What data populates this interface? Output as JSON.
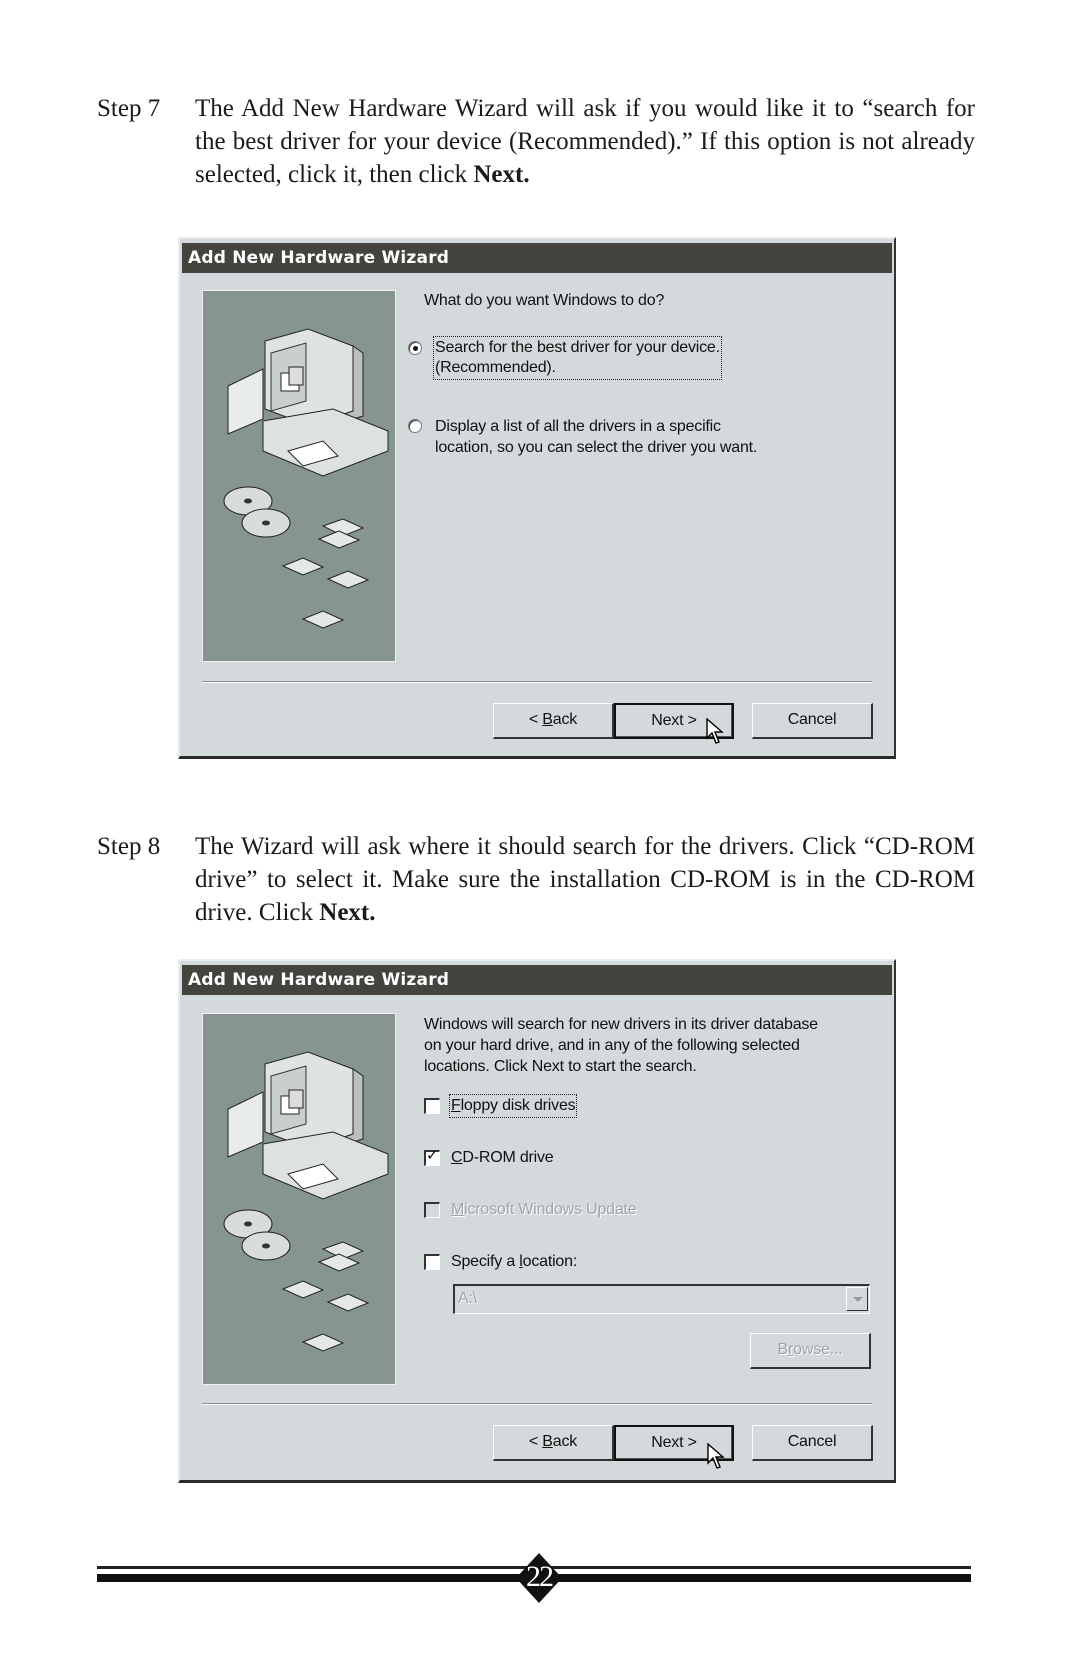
{
  "steps": [
    {
      "label": "Step 7",
      "text_before": "The Add New Hardware Wizard will ask if you would like it to “search for the best driver for your device (Recommended).” If this option is not already selected, click it, then click ",
      "text_bold": "Next."
    },
    {
      "label": "Step 8",
      "text_before": "The Wizard will ask where it should search for the drivers. Click “CD-ROM drive” to select it. Make sure the installation CD-ROM is in the CD-ROM drive. Click ",
      "text_bold": "Next."
    }
  ],
  "dialog1": {
    "title": "Add New Hardware Wizard",
    "prompt": "What do you want Windows to do?",
    "options": [
      {
        "line1": "Search for the best driver for your device.",
        "line2": "(Recommended).",
        "selected": true
      },
      {
        "line1": "Display a list of all the drivers in a specific",
        "line2": "location, so you can select the driver you want.",
        "selected": false
      }
    ],
    "buttons": {
      "back_prefix": "< ",
      "back_mnemonic": "B",
      "back_rest": "ack",
      "next": "Next >",
      "cancel": "Cancel"
    }
  },
  "dialog2": {
    "title": "Add New Hardware Wizard",
    "description": [
      "Windows will search for new drivers in its driver database",
      "on your hard drive, and in any of the following selected",
      "locations. Click Next to start the search."
    ],
    "checkboxes": [
      {
        "mnemonic": "F",
        "rest": "loppy disk drives",
        "checked": false,
        "disabled": false
      },
      {
        "mnemonic": "C",
        "rest": "D-ROM drive",
        "checked": true,
        "disabled": false
      },
      {
        "mnemonic": "M",
        "rest": "icrosoft Windows Update",
        "checked": false,
        "disabled": true
      },
      {
        "pre": "Specify a ",
        "mnemonic": "l",
        "rest": "ocation:",
        "checked": false,
        "disabled": false
      }
    ],
    "location_value": "A:\\",
    "browse": {
      "pre": "B",
      "mnemonic": "r",
      "rest": "owse..."
    },
    "buttons": {
      "back_prefix": "< ",
      "back_mnemonic": "B",
      "back_rest": "ack",
      "next": "Next >",
      "cancel": "Cancel"
    }
  },
  "footer": {
    "page_number": "22"
  }
}
